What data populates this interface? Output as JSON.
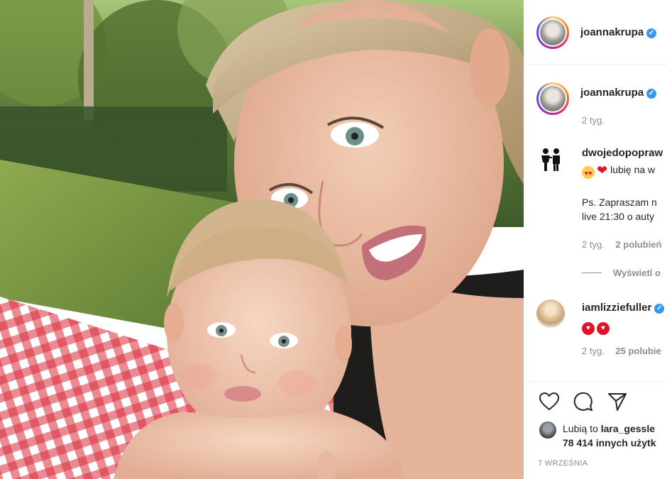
{
  "post": {
    "author": "joannakrupa",
    "verified": true,
    "date": "7 WRZEŚNIA"
  },
  "caption": {
    "author": "joannakrupa",
    "time": "2 tyg."
  },
  "comments": [
    {
      "author": "dwojedopopraw",
      "lines": [
        "lubię na w",
        "",
        "Ps. Zapraszam n",
        "live 21:30 o auty"
      ],
      "emoji": [
        "heart-eyes-emoji",
        "heart-emoji"
      ],
      "time": "2 tyg.",
      "likes": "2 polubień",
      "replies_label": "Wyświetl o"
    },
    {
      "author": "iamlizziefuller",
      "verified": true,
      "emoji": [
        "heart-emoji",
        "heart-emoji"
      ],
      "time": "2 tyg.",
      "likes": "25 polubie"
    }
  ],
  "likes_line1_prefix": "Lubią to ",
  "likes_line1_user": "lara_gessle",
  "likes_line2": "78 414 innych użytk",
  "colors": {
    "verified": "#3897f0",
    "heart": "#e0132a",
    "secondary_text": "#8e8e8e",
    "divider": "#efefef"
  }
}
